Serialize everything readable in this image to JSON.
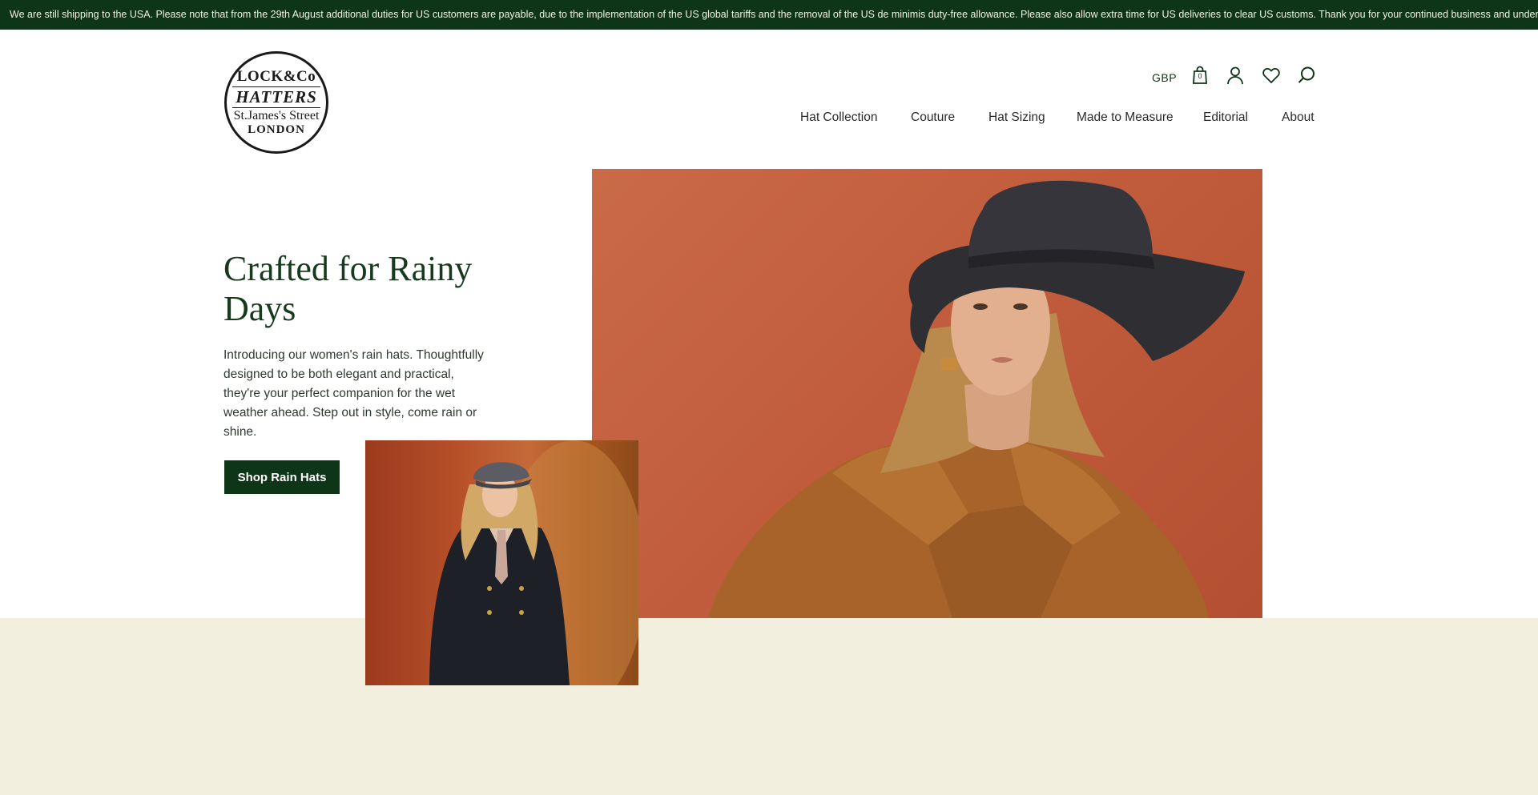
{
  "announcement": "We are still shipping to the USA. Please note that from the 29th August additional duties for US customers are payable, due to the implementation of the US global tariffs and the removal of the US de minimis duty-free allowance. Please also allow extra time for US deliveries to clear US customs. Thank you for your continued business and understanding.",
  "logo": {
    "line1": "LOCK&Co",
    "line2": "HATTERS",
    "line3": "St.James's Street",
    "line4": "LONDON"
  },
  "header": {
    "currency": "GBP",
    "bag_count": "0",
    "icons": [
      "bag-icon",
      "account-icon",
      "wishlist-heart-icon",
      "search-icon"
    ]
  },
  "nav": {
    "items": [
      {
        "label": "Hat Collection"
      },
      {
        "label": "Couture"
      },
      {
        "label": "Hat Sizing"
      },
      {
        "label": "Made to Measure"
      },
      {
        "label": "Editorial"
      },
      {
        "label": "About"
      }
    ]
  },
  "hero": {
    "title": "Crafted for Rainy Days",
    "body": "Introducing our women's rain hats. Thoughtfully designed to be both elegant and practical, they're your perfect companion for the wet weather ahead. Step out in style, come rain or shine.",
    "cta": "Shop Rain Hats"
  },
  "colors": {
    "brand_green": "#0f3518",
    "beige": "#f3efdf",
    "hero_background": "#c45f3f"
  }
}
